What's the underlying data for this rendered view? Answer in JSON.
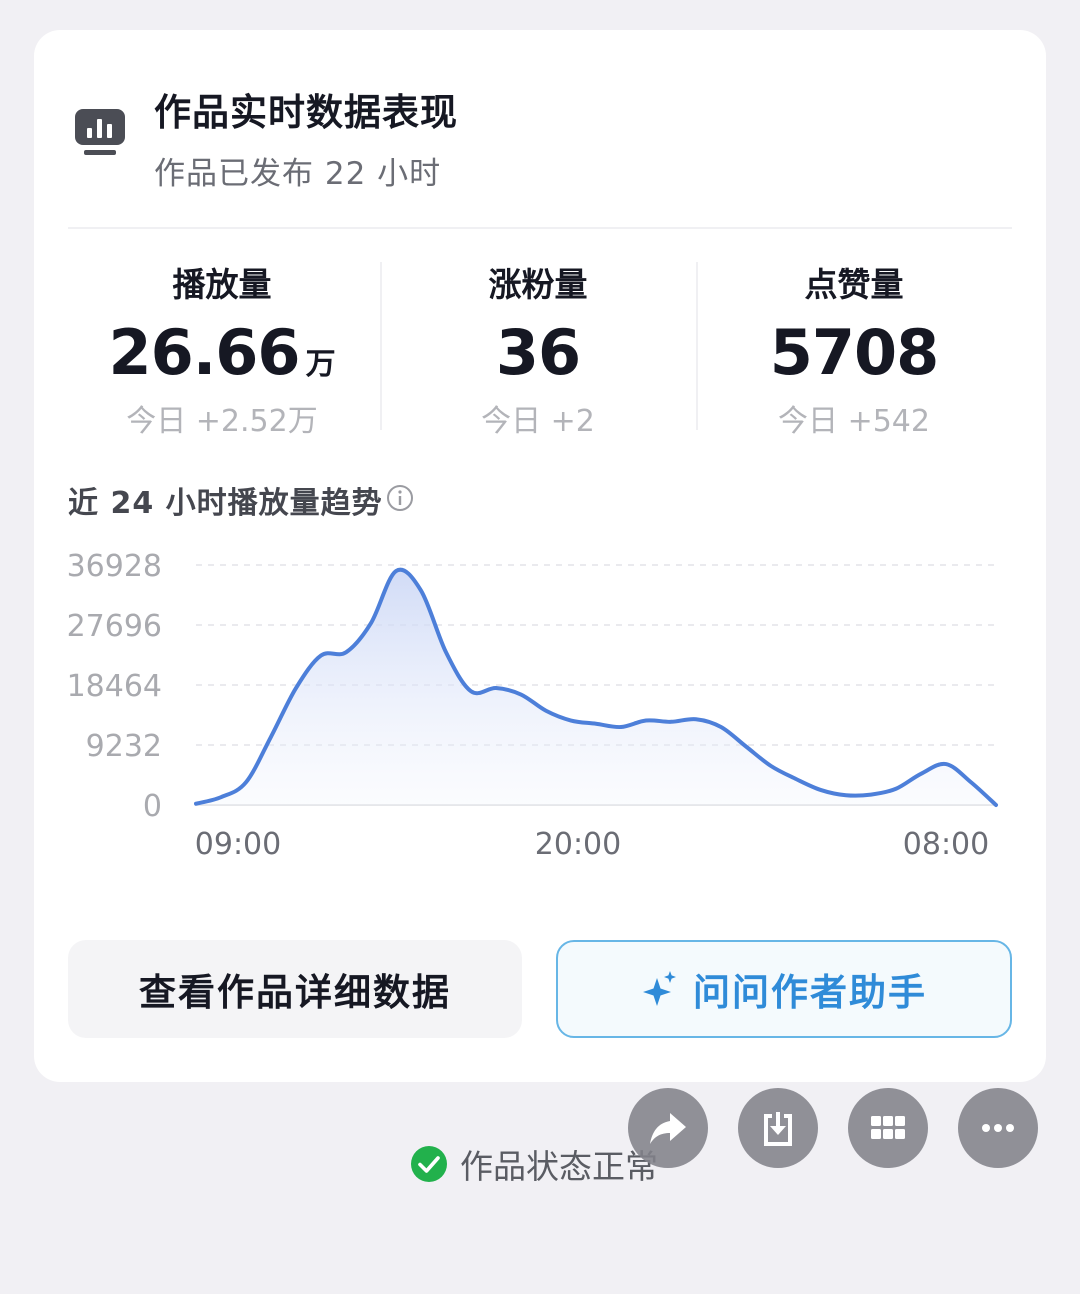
{
  "header": {
    "title": "作品实时数据表现",
    "subtitle": "作品已发布 22 小时",
    "icon": "bar-chart-monitor-icon"
  },
  "stats": [
    {
      "label": "播放量",
      "value": "26.66",
      "unit": "万",
      "today": "今日 +2.52万"
    },
    {
      "label": "涨粉量",
      "value": "36",
      "unit": "",
      "today": "今日 +2"
    },
    {
      "label": "点赞量",
      "value": "5708",
      "unit": "",
      "today": "今日 +542"
    }
  ],
  "trend": {
    "title": "近 24 小时播放量趋势",
    "info_icon": "info-circle-icon"
  },
  "chart_data": {
    "type": "area",
    "x_ticks": [
      "09:00",
      "20:00",
      "08:00"
    ],
    "y_ticks": [
      0,
      9232,
      18464,
      27696,
      36928
    ],
    "ylim": [
      0,
      36928
    ],
    "grid": true,
    "line_color": "#4d7fd9",
    "series": [
      {
        "values": [
          200,
          1200,
          3500,
          10500,
          18000,
          23000,
          23500,
          28000,
          36000,
          33000,
          23500,
          17500,
          18000,
          17000,
          14500,
          13000,
          12500,
          12000,
          13000,
          12800,
          13200,
          12000,
          9000,
          6000,
          4000,
          2300,
          1500,
          1600,
          2500,
          4800,
          6300,
          3500,
          0
        ]
      }
    ]
  },
  "buttons": {
    "detail_label": "查看作品详细数据",
    "assistant_label": "问问作者助手",
    "assistant_icon": "sparkle-icon"
  },
  "status": {
    "text": "作品状态正常",
    "icon": "check-circle-icon"
  },
  "fab_icons": [
    "share-icon",
    "download-icon",
    "grid-icon",
    "more-icon"
  ],
  "colors": {
    "accent": "#2f8bd8",
    "line": "#4d7fd9",
    "ok": "#22b14c"
  }
}
